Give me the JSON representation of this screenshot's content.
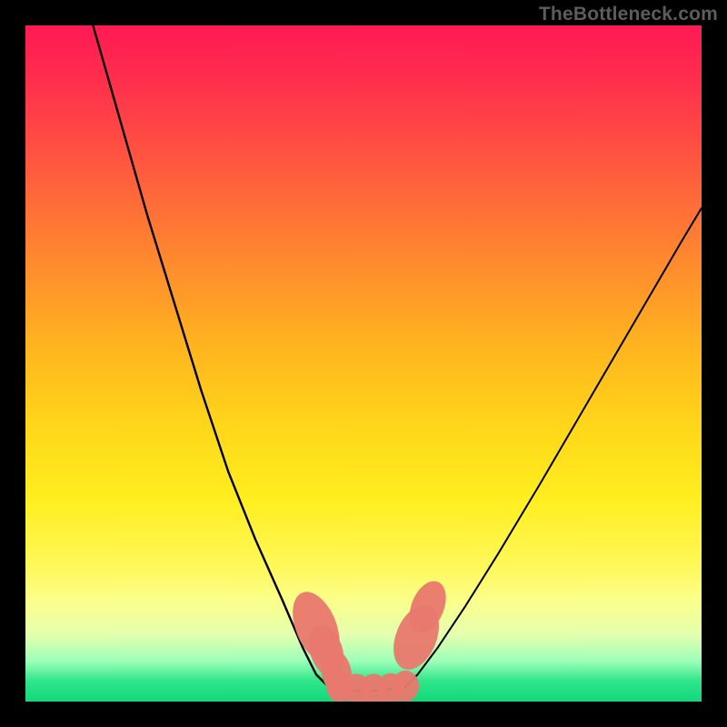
{
  "watermark": "TheBottleneck.com",
  "chart_data": {
    "type": "line",
    "title": "",
    "xlabel": "",
    "ylabel": "",
    "xlim": [
      0,
      100
    ],
    "ylim": [
      0,
      100
    ],
    "grid": false,
    "legend": false,
    "background_gradient": {
      "direction": "vertical",
      "stops": [
        {
          "pos": 0,
          "color": "#ff1a55"
        },
        {
          "pos": 35,
          "color": "#ff8a2e"
        },
        {
          "pos": 60,
          "color": "#ffd81a"
        },
        {
          "pos": 85,
          "color": "#fbff8a"
        },
        {
          "pos": 100,
          "color": "#13d77b"
        }
      ]
    },
    "series": [
      {
        "name": "left-branch",
        "color": "#000000",
        "width": 2.4,
        "x": [
          10,
          14,
          18,
          22,
          26,
          30,
          34,
          38,
          41,
          43,
          45
        ],
        "y": [
          100,
          86,
          72,
          59,
          46,
          34,
          24,
          15,
          8,
          4,
          2
        ]
      },
      {
        "name": "right-branch",
        "color": "#000000",
        "width": 2.0,
        "x": [
          56,
          58,
          61,
          65,
          70,
          76,
          83,
          90,
          97,
          100
        ],
        "y": [
          2,
          4,
          8,
          14,
          22,
          32,
          44,
          56,
          68,
          73
        ]
      },
      {
        "name": "valley-floor",
        "color": "#000000",
        "width": 2.2,
        "x": [
          45,
          50,
          56
        ],
        "y": [
          2,
          1.5,
          2
        ]
      }
    ],
    "markers": [
      {
        "name": "left-marker-a",
        "x": 43,
        "y": 11,
        "rx": 3.0,
        "ry": 5.5,
        "rot": -22,
        "color": "#e9786e"
      },
      {
        "name": "left-marker-b",
        "x": 44.5,
        "y": 7.5,
        "rx": 2.4,
        "ry": 4.0,
        "rot": -18,
        "color": "#e9786e"
      },
      {
        "name": "left-marker-c",
        "x": 46,
        "y": 4.3,
        "rx": 2.2,
        "ry": 3.5,
        "rot": -12,
        "color": "#e9786e"
      },
      {
        "name": "floor-marker-1",
        "x": 46.5,
        "y": 2.2,
        "rx": 2.0,
        "ry": 2.3,
        "rot": 0,
        "color": "#e9786e"
      },
      {
        "name": "floor-marker-2",
        "x": 49,
        "y": 1.8,
        "rx": 2.0,
        "ry": 2.3,
        "rot": 0,
        "color": "#e9786e"
      },
      {
        "name": "floor-marker-3",
        "x": 51.5,
        "y": 1.8,
        "rx": 2.0,
        "ry": 2.3,
        "rot": 0,
        "color": "#e9786e"
      },
      {
        "name": "floor-marker-4",
        "x": 54,
        "y": 1.9,
        "rx": 2.0,
        "ry": 2.3,
        "rot": 0,
        "color": "#e9786e"
      },
      {
        "name": "floor-marker-5",
        "x": 56.2,
        "y": 2.3,
        "rx": 2.0,
        "ry": 2.3,
        "rot": 0,
        "color": "#e9786e"
      },
      {
        "name": "right-marker-a",
        "x": 57.8,
        "y": 9.5,
        "rx": 3.0,
        "ry": 5.0,
        "rot": 22,
        "color": "#e9786e"
      },
      {
        "name": "right-marker-b",
        "x": 59.5,
        "y": 14,
        "rx": 2.4,
        "ry": 4.0,
        "rot": 22,
        "color": "#e9786e"
      }
    ]
  }
}
